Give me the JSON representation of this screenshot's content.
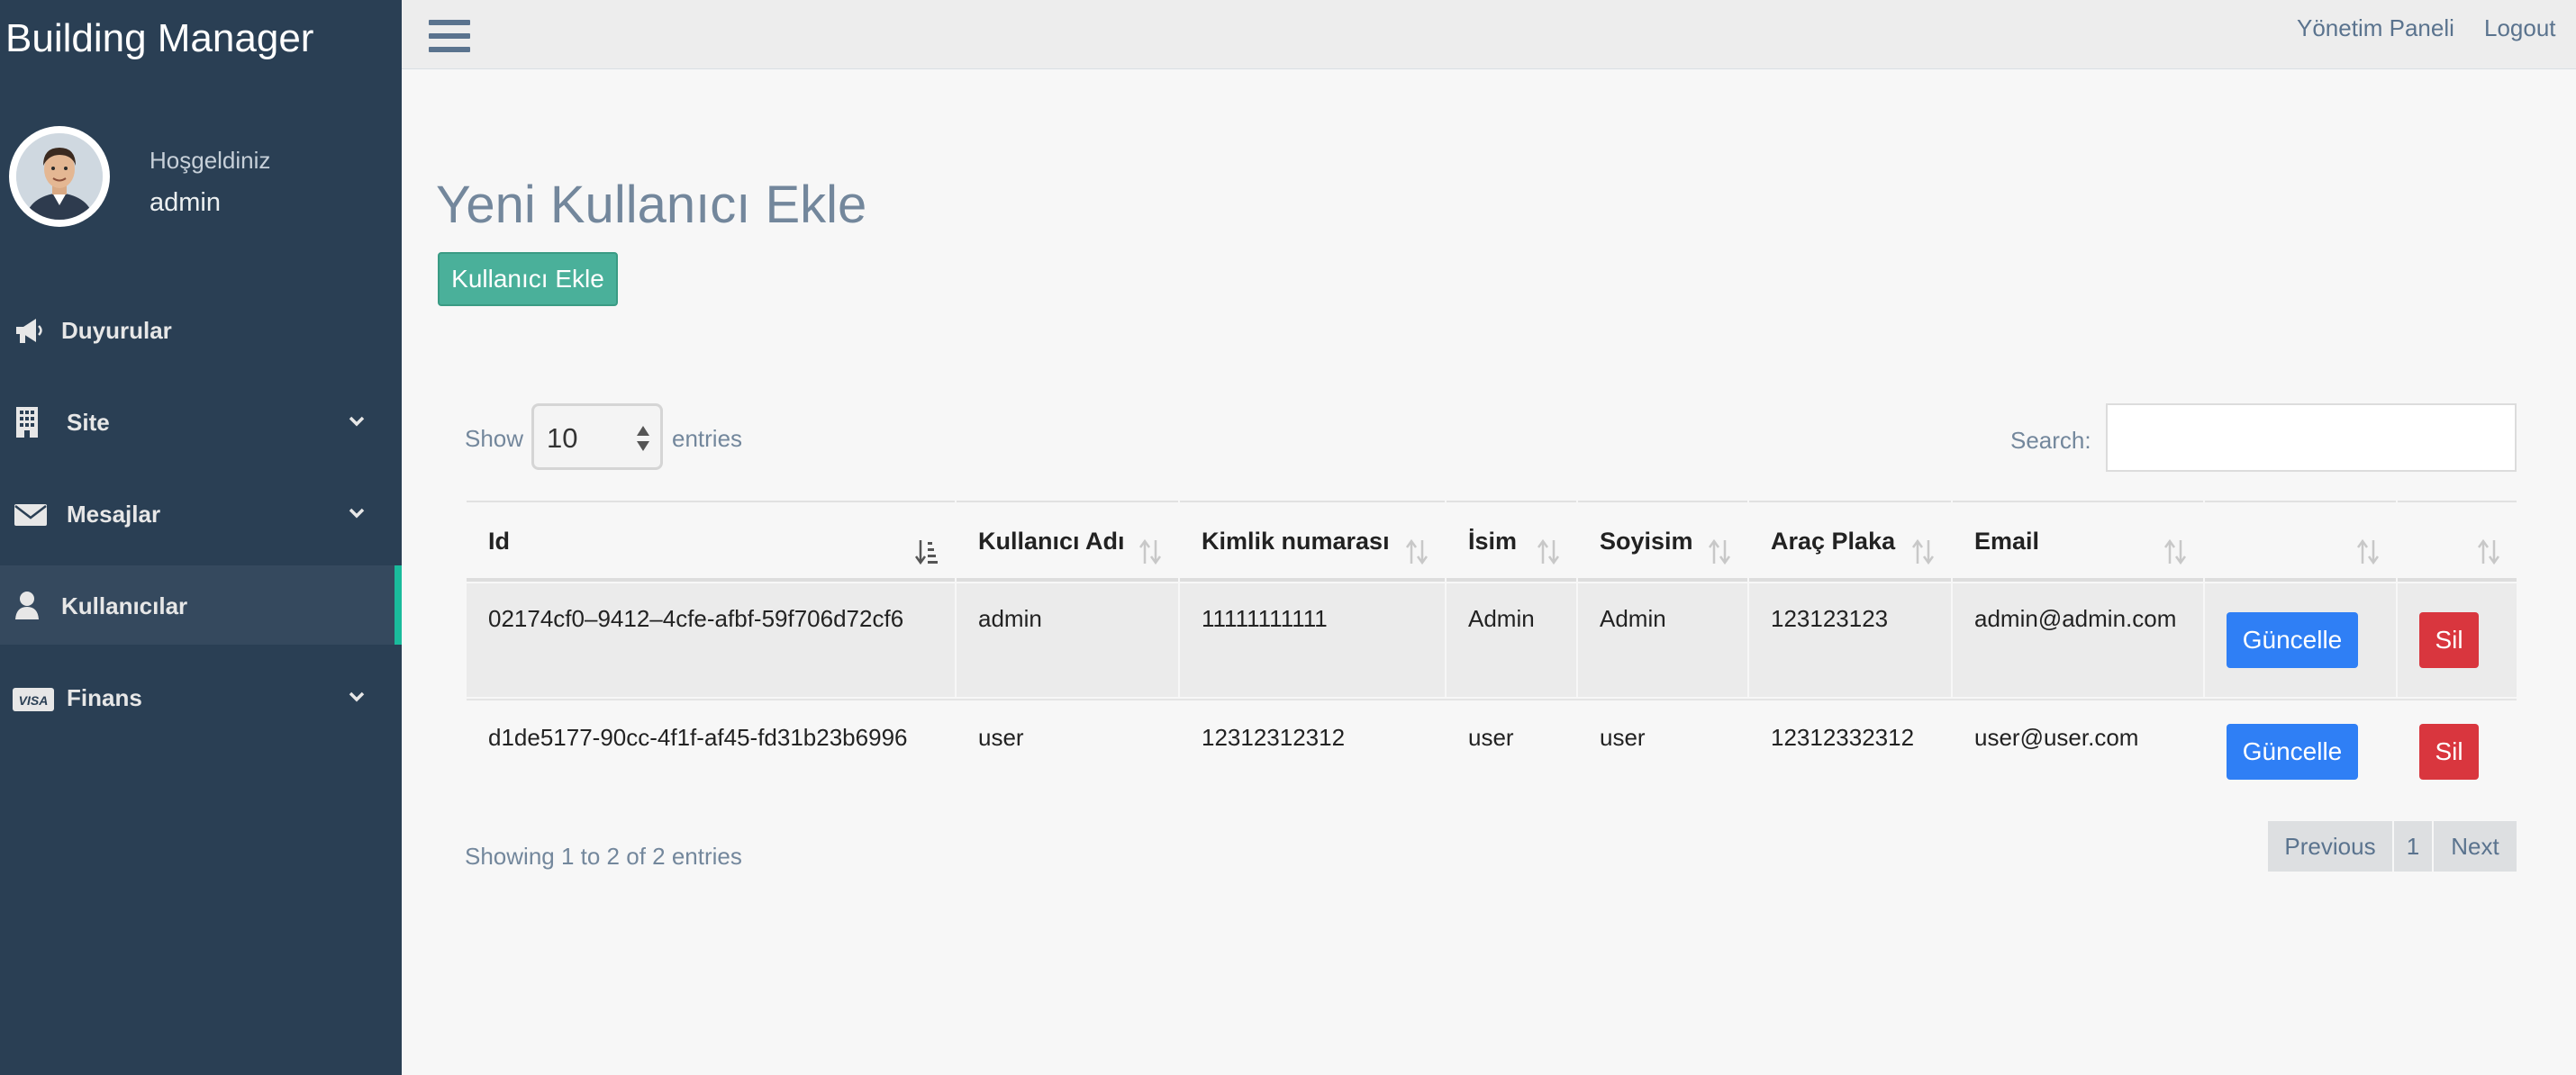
{
  "sidebar": {
    "brand": "Building Manager",
    "welcome": "Hoşgeldiniz",
    "username": "admin",
    "items": [
      {
        "label": "Duyurular",
        "icon": "megaphone-icon"
      },
      {
        "label": "Site",
        "icon": "building-icon",
        "expandable": true
      },
      {
        "label": "Mesajlar",
        "icon": "envelope-icon",
        "expandable": true
      },
      {
        "label": "Kullanıcılar",
        "icon": "user-icon",
        "active": true
      },
      {
        "label": "Finans",
        "icon": "visa-card-icon",
        "expandable": true
      }
    ]
  },
  "topbar": {
    "panel_link": "Yönetim Paneli",
    "logout_link": "Logout"
  },
  "page": {
    "title": "Yeni Kullanıcı Ekle",
    "add_button": "Kullanıcı Ekle"
  },
  "table_controls": {
    "show_label": "Show",
    "entries_value": "10",
    "entries_label": "entries",
    "search_label": "Search:",
    "search_value": ""
  },
  "table": {
    "headers": [
      "Id",
      "Kullanıcı Adı",
      "Kimlik numarası",
      "İsim",
      "Soyisim",
      "Araç Plaka",
      "Email",
      "",
      ""
    ],
    "rows": [
      {
        "id": "02174cf0–9412–4cfe-afbf-59f706d72cf6",
        "kullanici_adi": "admin",
        "kimlik": "11111111111",
        "isim": "Admin",
        "soyisim": "Admin",
        "plaka": "123123123",
        "email": "admin@admin.com",
        "update": "Güncelle",
        "delete": "Sil"
      },
      {
        "id": "d1de5177-90cc-4f1f-af45-fd31b23b6996",
        "kullanici_adi": "user",
        "kimlik": "12312312312",
        "isim": "user",
        "soyisim": "user",
        "plaka": "12312332312",
        "email": "user@user.com",
        "update": "Güncelle",
        "delete": "Sil"
      }
    ],
    "info": "Showing 1 to 2 of 2 entries"
  },
  "pagination": {
    "previous": "Previous",
    "current_page": "1",
    "next": "Next"
  },
  "colors": {
    "sidebar_bg": "#2a3f54",
    "active_accent": "#1abb9c",
    "add_button": "#4ab09a",
    "update_button": "#2f7ff5",
    "delete_button": "#d9363e"
  }
}
